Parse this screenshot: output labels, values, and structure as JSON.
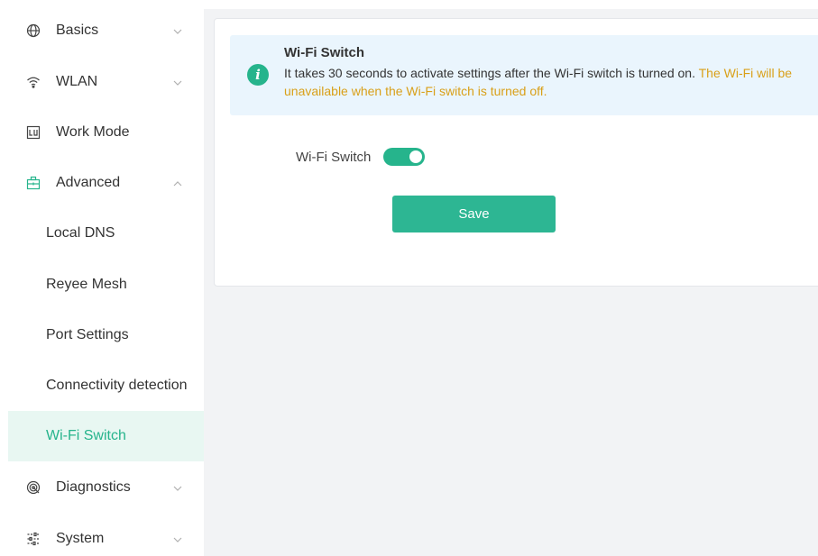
{
  "sidebar": {
    "items": [
      {
        "label": "Basics",
        "icon": "globe-icon",
        "chevron": "down"
      },
      {
        "label": "WLAN",
        "icon": "wifi-icon",
        "chevron": "down"
      },
      {
        "label": "Work Mode",
        "icon": "work-mode-icon"
      },
      {
        "label": "Advanced",
        "icon": "toolbox-icon",
        "chevron": "up"
      },
      {
        "label": "Local DNS"
      },
      {
        "label": "Reyee Mesh"
      },
      {
        "label": "Port Settings"
      },
      {
        "label": "Connectivity detection"
      },
      {
        "label": "Wi-Fi Switch",
        "active": true
      },
      {
        "label": "Diagnostics",
        "icon": "diagnostics-icon",
        "chevron": "down"
      },
      {
        "label": "System",
        "icon": "sliders-icon",
        "chevron": "down"
      }
    ]
  },
  "notice": {
    "icon": "info-icon",
    "icon_glyph": "i",
    "title": "Wi-Fi Switch",
    "text": "It takes 30 seconds to activate settings after the Wi-Fi switch is turned on.",
    "warning": "The Wi-Fi will be unavailable when the Wi-Fi switch is turned off."
  },
  "form": {
    "switch_label": "Wi-Fi Switch",
    "switch_on": true,
    "save_label": "Save"
  },
  "colors": {
    "accent": "#26b48c",
    "warning": "#d9a019",
    "notice_bg": "#eaf5fd",
    "active_bg": "#e8f7f2",
    "content_bg": "#f2f3f5"
  }
}
